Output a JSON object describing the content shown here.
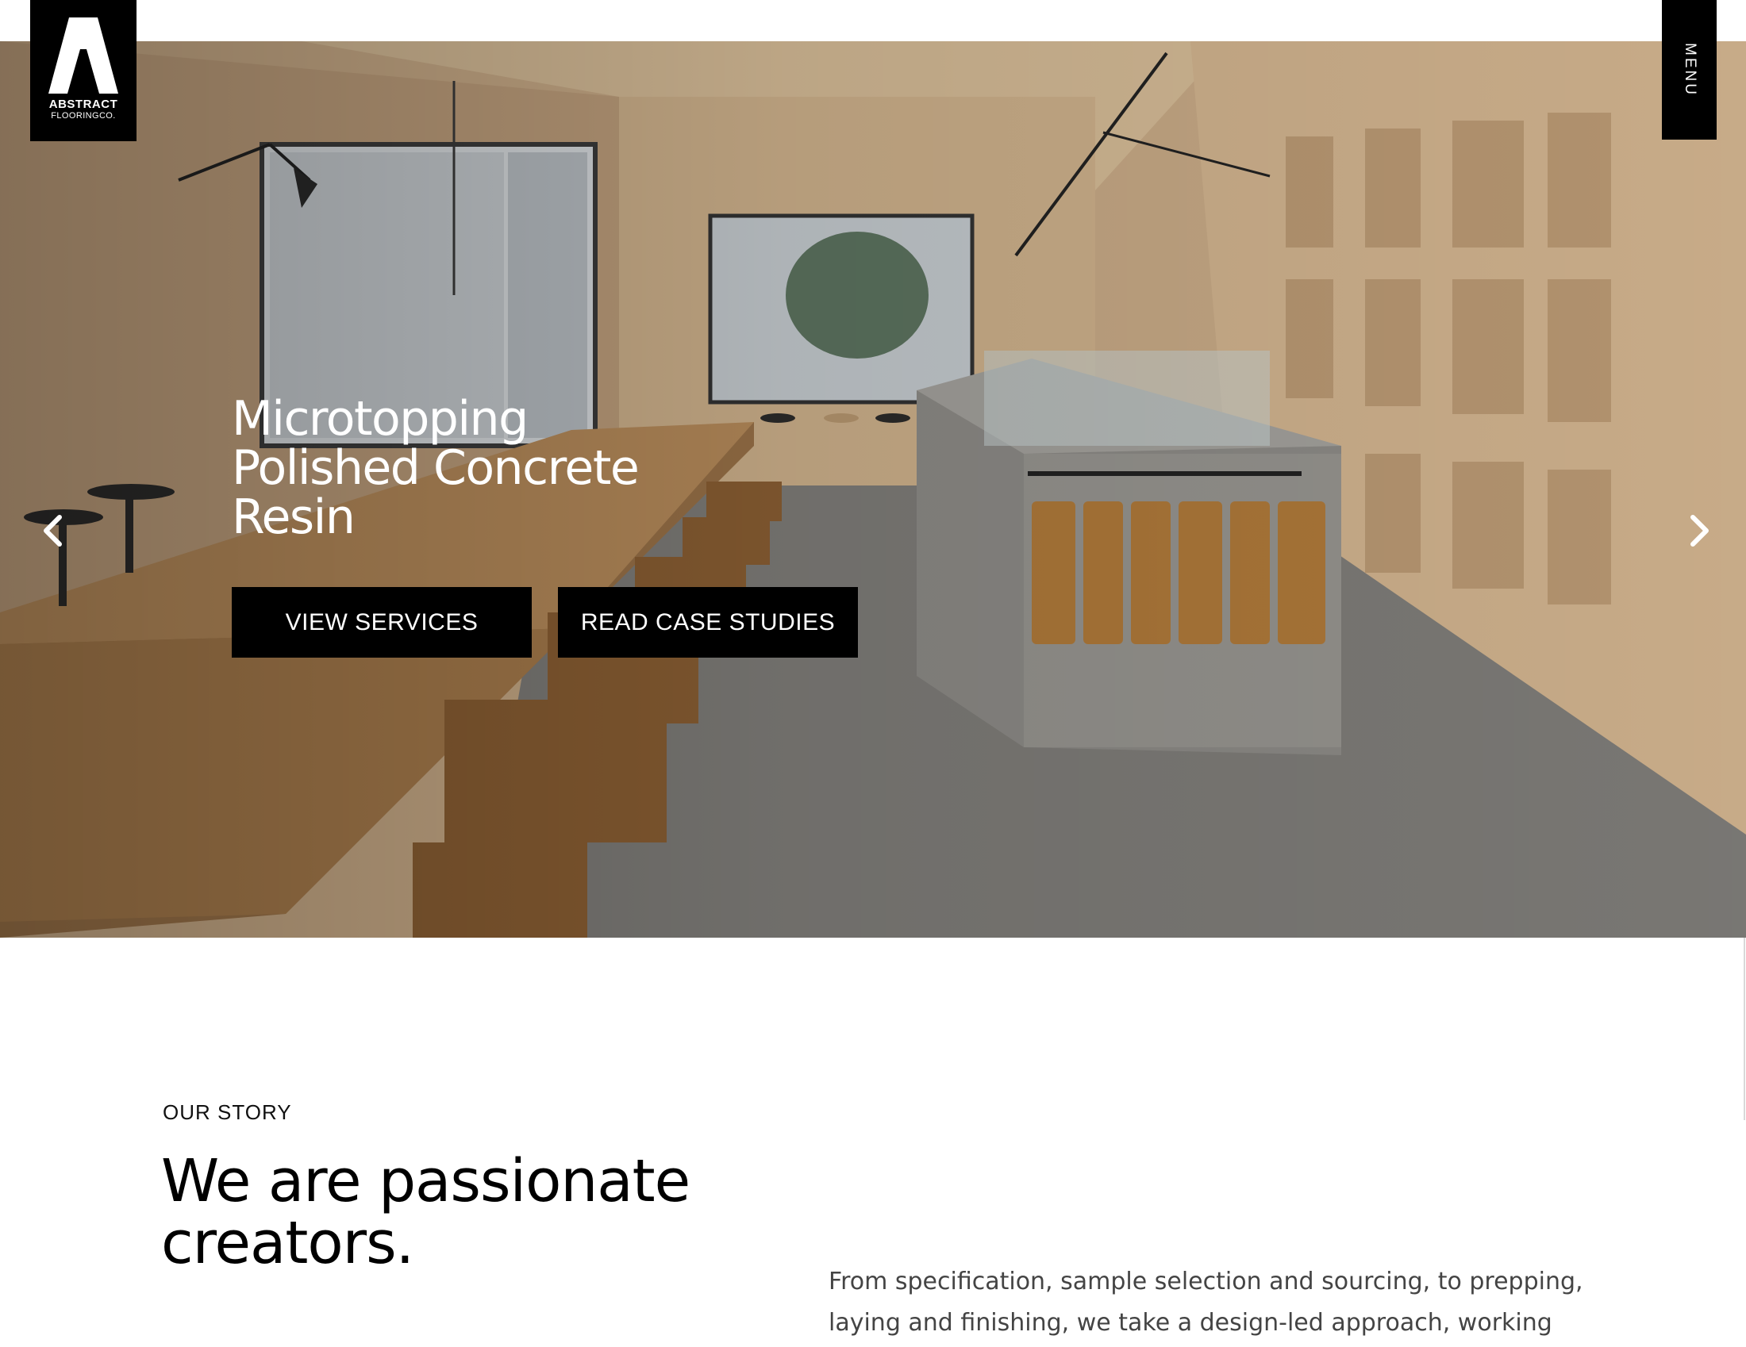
{
  "brand": {
    "name": "ABSTRACT",
    "sub": "FLOORINGCO."
  },
  "menu": {
    "label": "MENU"
  },
  "hero": {
    "title_lines": [
      "Microtopping",
      "Polished Concrete",
      "Resin"
    ],
    "buttons": {
      "services": "VIEW SERVICES",
      "cases": "READ CASE STUDIES"
    },
    "icons": {
      "prev": "chevron-left-icon",
      "next": "chevron-right-icon"
    }
  },
  "story": {
    "eyebrow": "OUR STORY",
    "heading_lines": [
      "We are passionate",
      "creators."
    ],
    "body_lines": [
      "From specification, sample selection and sourcing, to prepping,",
      "laying and finishing, we take a design-led approach, working"
    ]
  },
  "colors": {
    "black": "#000000",
    "white": "#ffffff",
    "body_text": "#444444"
  }
}
